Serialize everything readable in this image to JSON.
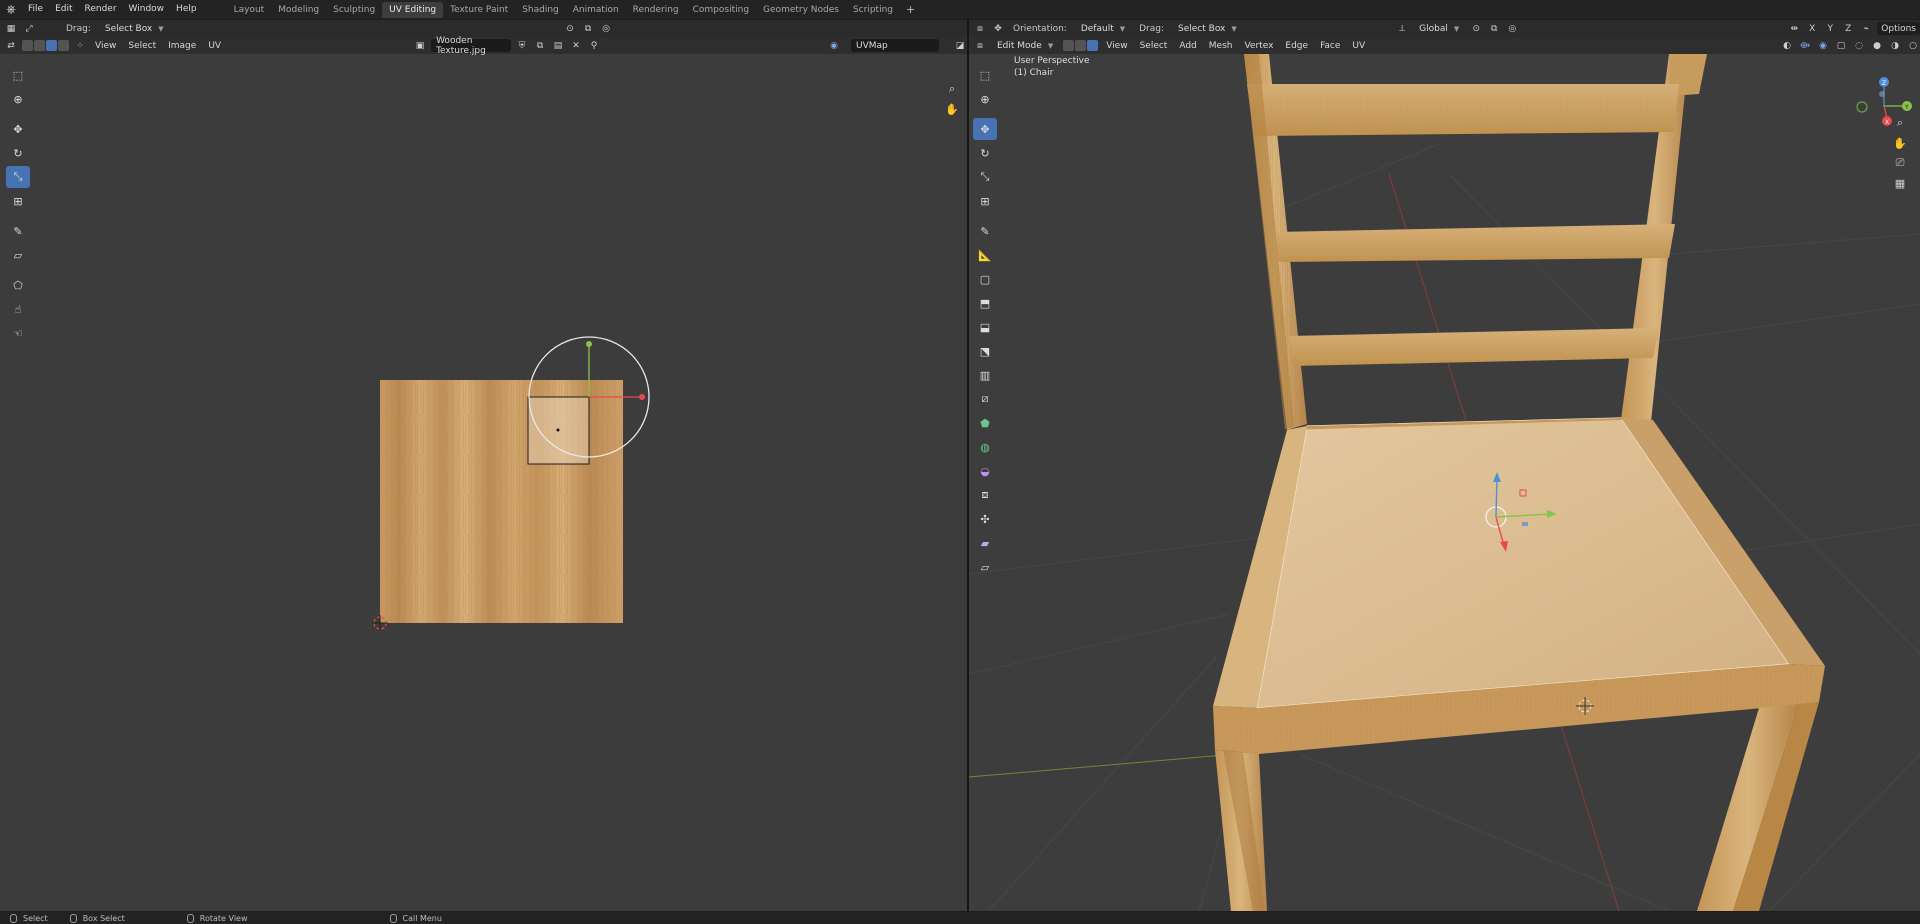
{
  "topbar": {
    "menus": [
      "File",
      "Edit",
      "Render",
      "Window",
      "Help"
    ],
    "workspaces": [
      "Layout",
      "Modeling",
      "Sculpting",
      "UV Editing",
      "Texture Paint",
      "Shading",
      "Animation",
      "Rendering",
      "Compositing",
      "Geometry Nodes",
      "Scripting"
    ],
    "active_workspace": "UV Editing",
    "add_label": "+"
  },
  "uv_editor": {
    "drag_label": "Drag:",
    "drag_value": "Select Box",
    "menus": [
      "View",
      "Select",
      "Image",
      "UV"
    ],
    "image_name": "Wooden Texture.jpg",
    "uv_map": "UVMap"
  },
  "viewport": {
    "orientation_label": "Orientation:",
    "orientation_value": "Default",
    "drag_label": "Drag:",
    "drag_value": "Select Box",
    "transform_orientation": "Global",
    "options_label": "Options",
    "mode": "Edit Mode",
    "menus": [
      "View",
      "Select",
      "Add",
      "Mesh",
      "Vertex",
      "Edge",
      "Face",
      "UV"
    ],
    "perspective_label": "User Perspective",
    "object_label": "(1) Chair",
    "gizmo_axes": [
      "X",
      "Y",
      "Z"
    ]
  },
  "statusbar": {
    "items": [
      "Select",
      "Box Select",
      "Rotate View",
      "Call Menu"
    ]
  },
  "colors": {
    "accent": "#4772b3",
    "x_axis": "#e8484e",
    "y_axis": "#8bc34a",
    "z_axis": "#4f8fd8",
    "wood_light": "#d9b582",
    "wood_mid": "#c49a5f"
  }
}
